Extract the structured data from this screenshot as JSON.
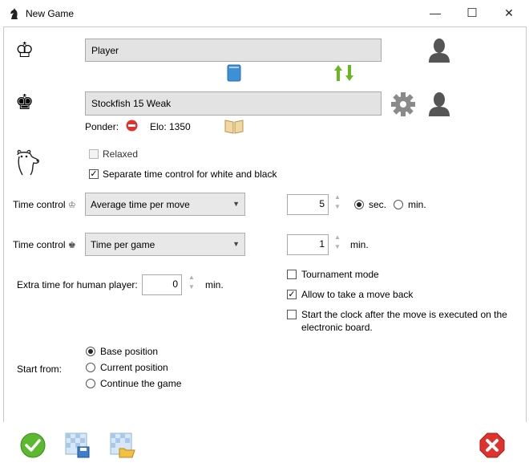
{
  "window": {
    "title": "New Game",
    "minimize": "—",
    "maximize": "☐",
    "close": "✕"
  },
  "white": {
    "icon": "white-king-icon",
    "name": "Player"
  },
  "black": {
    "icon": "black-king-icon",
    "name": "Stockfish 15 Weak",
    "ponder_label": "Ponder:",
    "elo_label": "Elo: 1350"
  },
  "options": {
    "relaxed_label": "Relaxed",
    "relaxed_checked": false,
    "separate_time_label": "Separate time control for white and black",
    "separate_time_checked": true
  },
  "time_control_white": {
    "label": "Time control",
    "mode": "Average time per move",
    "value": "5",
    "unit_sec": "sec.",
    "unit_min": "min.",
    "selected_unit": "sec."
  },
  "time_control_black": {
    "label": "Time control",
    "mode": "Time per game",
    "value": "1",
    "unit": "min."
  },
  "extra_time": {
    "label": "Extra time for human player:",
    "value": "0",
    "unit": "min."
  },
  "checks": {
    "tournament_label": "Tournament mode",
    "tournament_checked": false,
    "take_back_label": "Allow to take a move back",
    "take_back_checked": true,
    "start_clock_label_1": "Start the clock after the move is executed on the",
    "start_clock_label_2": "electronic board.",
    "start_clock_checked": false
  },
  "start_from": {
    "label": "Start from:",
    "options": [
      "Base position",
      "Current position",
      "Continue the game"
    ],
    "selected": "Base position"
  },
  "colors": {
    "ok_green": "#5cb82e",
    "cancel_red": "#e0322d",
    "book_blue": "#3d8fd6",
    "swap_green": "#6ab724"
  }
}
